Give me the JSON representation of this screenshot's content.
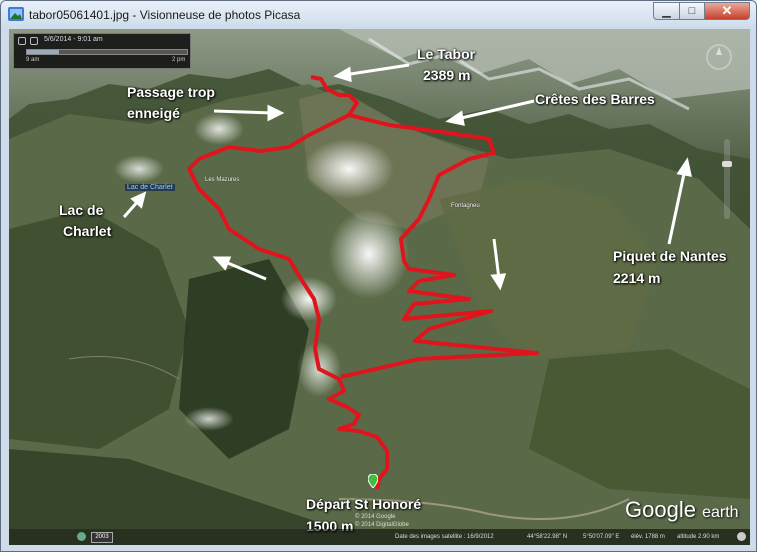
{
  "window": {
    "title": "tabor05061401.jpg - Visionneuse de photos Picasa",
    "minimize_icon": "minimize-icon",
    "maximize_icon": "maximize-icon",
    "close_icon": "close-icon"
  },
  "timeline": {
    "date": "5/6/2014 - 9:01 am",
    "start": "9 am",
    "end": "2 pm",
    "progress": 0.2
  },
  "labels": {
    "tabor_name": "Le Tabor",
    "tabor_alt": "2389 m",
    "passage_line1": "Passage trop",
    "passage_line2": "enneigé",
    "cretes": "Crêtes des Barres",
    "lac_line1": "Lac de",
    "lac_line2": "Charlet",
    "piquet_name": "Piquet de Nantes",
    "piquet_alt": "2214 m",
    "depart_name": "Départ St Honoré",
    "depart_alt": "1500 m"
  },
  "map_small_labels": {
    "lac_tag": "Lac de Charlet",
    "les_mazures": "Les Mazures",
    "le_fontagneu": "Fontagneu"
  },
  "watermark": {
    "logo_google": "Google",
    "logo_earth": "earth",
    "copyright_1": "© 2014 Google",
    "copyright_2": "© 2014 DigitalGlobe"
  },
  "statusbar": {
    "year": "2003",
    "imagery_date": "Date des images satellite : 16/9/2012",
    "lat": "44°58'22.98\" N",
    "lon": "5°50'07.09\" E",
    "elev": "élév. 1788 m",
    "altitude": "altitude 2.90 km"
  },
  "colors": {
    "route": "#e0141c",
    "arrow": "#ffffff",
    "close_button": "#c7412b"
  }
}
